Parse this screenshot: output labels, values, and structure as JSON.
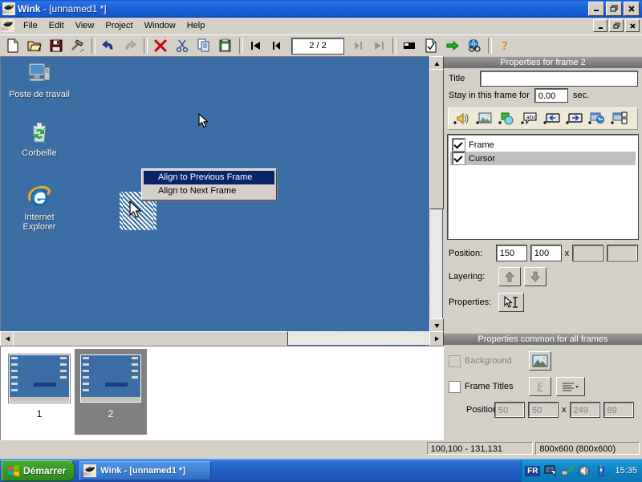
{
  "window": {
    "title_app": "Wink",
    "title_doc": " - [unnamed1 *]",
    "minimize": "_",
    "maximize": "❐",
    "close": "✕",
    "mdi_minimize": "_",
    "mdi_maximize": "❐",
    "mdi_close": "✕"
  },
  "menu": {
    "items": [
      {
        "label": "File"
      },
      {
        "label": "Edit"
      },
      {
        "label": "View"
      },
      {
        "label": "Project"
      },
      {
        "label": "Window"
      },
      {
        "label": "Help"
      }
    ]
  },
  "toolbar": {
    "new": "new-document",
    "open": "open-folder",
    "save": "save-floppy",
    "build": "hammer",
    "undo": "undo-arrow",
    "redo": "redo-arrow",
    "delete": "red-x",
    "cut": "scissors",
    "copy": "copy-pages",
    "paste": "clipboard",
    "first_frame": "first-frame",
    "prev_frame": "previous-frame",
    "page_value": "2 / 2",
    "next_frame": "next-frame",
    "last_frame": "last-frame",
    "capture": "capture-window",
    "render": "render-document",
    "export": "green-arrow",
    "preview_browser": "browser-globe",
    "help": "help-key"
  },
  "desktop": {
    "icons": [
      {
        "label": "Poste de travail",
        "icon": "my-computer-icon"
      },
      {
        "label": "Corbeille",
        "icon": "recycle-bin-icon"
      },
      {
        "label": "Internet\nExplorer",
        "label_line1": "Internet",
        "label_line2": "Explorer",
        "icon": "internet-explorer-icon"
      }
    ],
    "background_color": "#3a6ea5"
  },
  "context_menu": {
    "items": [
      {
        "label": "Align to Previous Frame",
        "selected": true
      },
      {
        "label": "Align to Next Frame",
        "selected": false
      }
    ]
  },
  "frame_properties": {
    "header": "Properties for frame 2",
    "title_label": "Title",
    "title_value": "",
    "stay_label": "Stay in this frame for",
    "stay_value": "0.00",
    "stay_unit": "sec.",
    "object_buttons": [
      {
        "icon": "add-sound-icon"
      },
      {
        "icon": "add-image-icon"
      },
      {
        "icon": "add-shape-icon"
      },
      {
        "icon": "add-text-callout-icon"
      },
      {
        "icon": "add-previous-button-icon"
      },
      {
        "icon": "add-next-button-icon"
      },
      {
        "icon": "add-browser-link-icon"
      },
      {
        "icon": "add-window-icon"
      }
    ],
    "objects": [
      {
        "label": "Frame",
        "checked": true,
        "highlighted": false
      },
      {
        "label": "Cursor",
        "checked": true,
        "highlighted": true
      }
    ],
    "position_label": "Position:",
    "position_x": "150",
    "position_y": "100",
    "position_sep": "x",
    "position_w": "",
    "position_h": "",
    "layering_label": "Layering:",
    "layer_up": "↑",
    "layer_down": "↓",
    "properties_label": "Properties:",
    "properties_icon": "cursor-text-properties-icon"
  },
  "common_properties": {
    "header": "Properties common for all frames",
    "background_label": "Background",
    "background_checked": false,
    "background_disabled": true,
    "background_icon": "image-icon",
    "frame_titles_label": "Frame Titles",
    "frame_titles_checked": false,
    "font_icon": "F",
    "align_icon": "align-lines-icon",
    "position_label": "Position:",
    "position_x": "50",
    "position_y": "50",
    "position_sep": "x",
    "position_w": "249",
    "position_h": "89"
  },
  "filmstrip": {
    "frames": [
      {
        "label": "1",
        "selected": false
      },
      {
        "label": "2",
        "selected": true
      }
    ]
  },
  "statusbar": {
    "selection": "100,100 - 131,131",
    "dimensions": "800x600 (800x600)"
  },
  "taskbar": {
    "start_label": "Démarrer",
    "start_icon": "windows-logo-icon",
    "tasks": [
      {
        "label": "Wink - [unnamed1 *]",
        "icon": "wink-icon"
      }
    ],
    "tray": {
      "language": "FR",
      "icons": [
        {
          "icon": "display-icon"
        },
        {
          "icon": "network-icon"
        },
        {
          "icon": "volume-icon"
        },
        {
          "icon": "battery-icon"
        }
      ],
      "clock": "15:35"
    }
  }
}
